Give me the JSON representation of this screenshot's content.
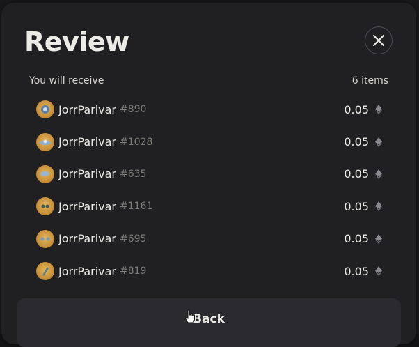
{
  "modal": {
    "title": "Review",
    "close_icon": "close-icon"
  },
  "summary": {
    "label": "You will receive",
    "count": "6 items"
  },
  "items": [
    {
      "name": "JorrParivar",
      "number": "#890",
      "price": "0.05",
      "currency_icon": "eth-icon"
    },
    {
      "name": "JorrParivar",
      "number": "#1028",
      "price": "0.05",
      "currency_icon": "eth-icon"
    },
    {
      "name": "JorrParivar",
      "number": "#635",
      "price": "0.05",
      "currency_icon": "eth-icon"
    },
    {
      "name": "JorrParivar",
      "number": "#1161",
      "price": "0.05",
      "currency_icon": "eth-icon"
    },
    {
      "name": "JorrParivar",
      "number": "#695",
      "price": "0.05",
      "currency_icon": "eth-icon"
    },
    {
      "name": "JorrParivar",
      "number": "#819",
      "price": "0.05",
      "currency_icon": "eth-icon"
    }
  ],
  "footer": {
    "back_label": "Back"
  },
  "colors": {
    "modal_bg": "#202023",
    "text_primary": "#ecebe6",
    "text_muted": "#7d7c78",
    "button_bg": "#2b2b2f",
    "avatar_gold": "#d9a94e"
  }
}
